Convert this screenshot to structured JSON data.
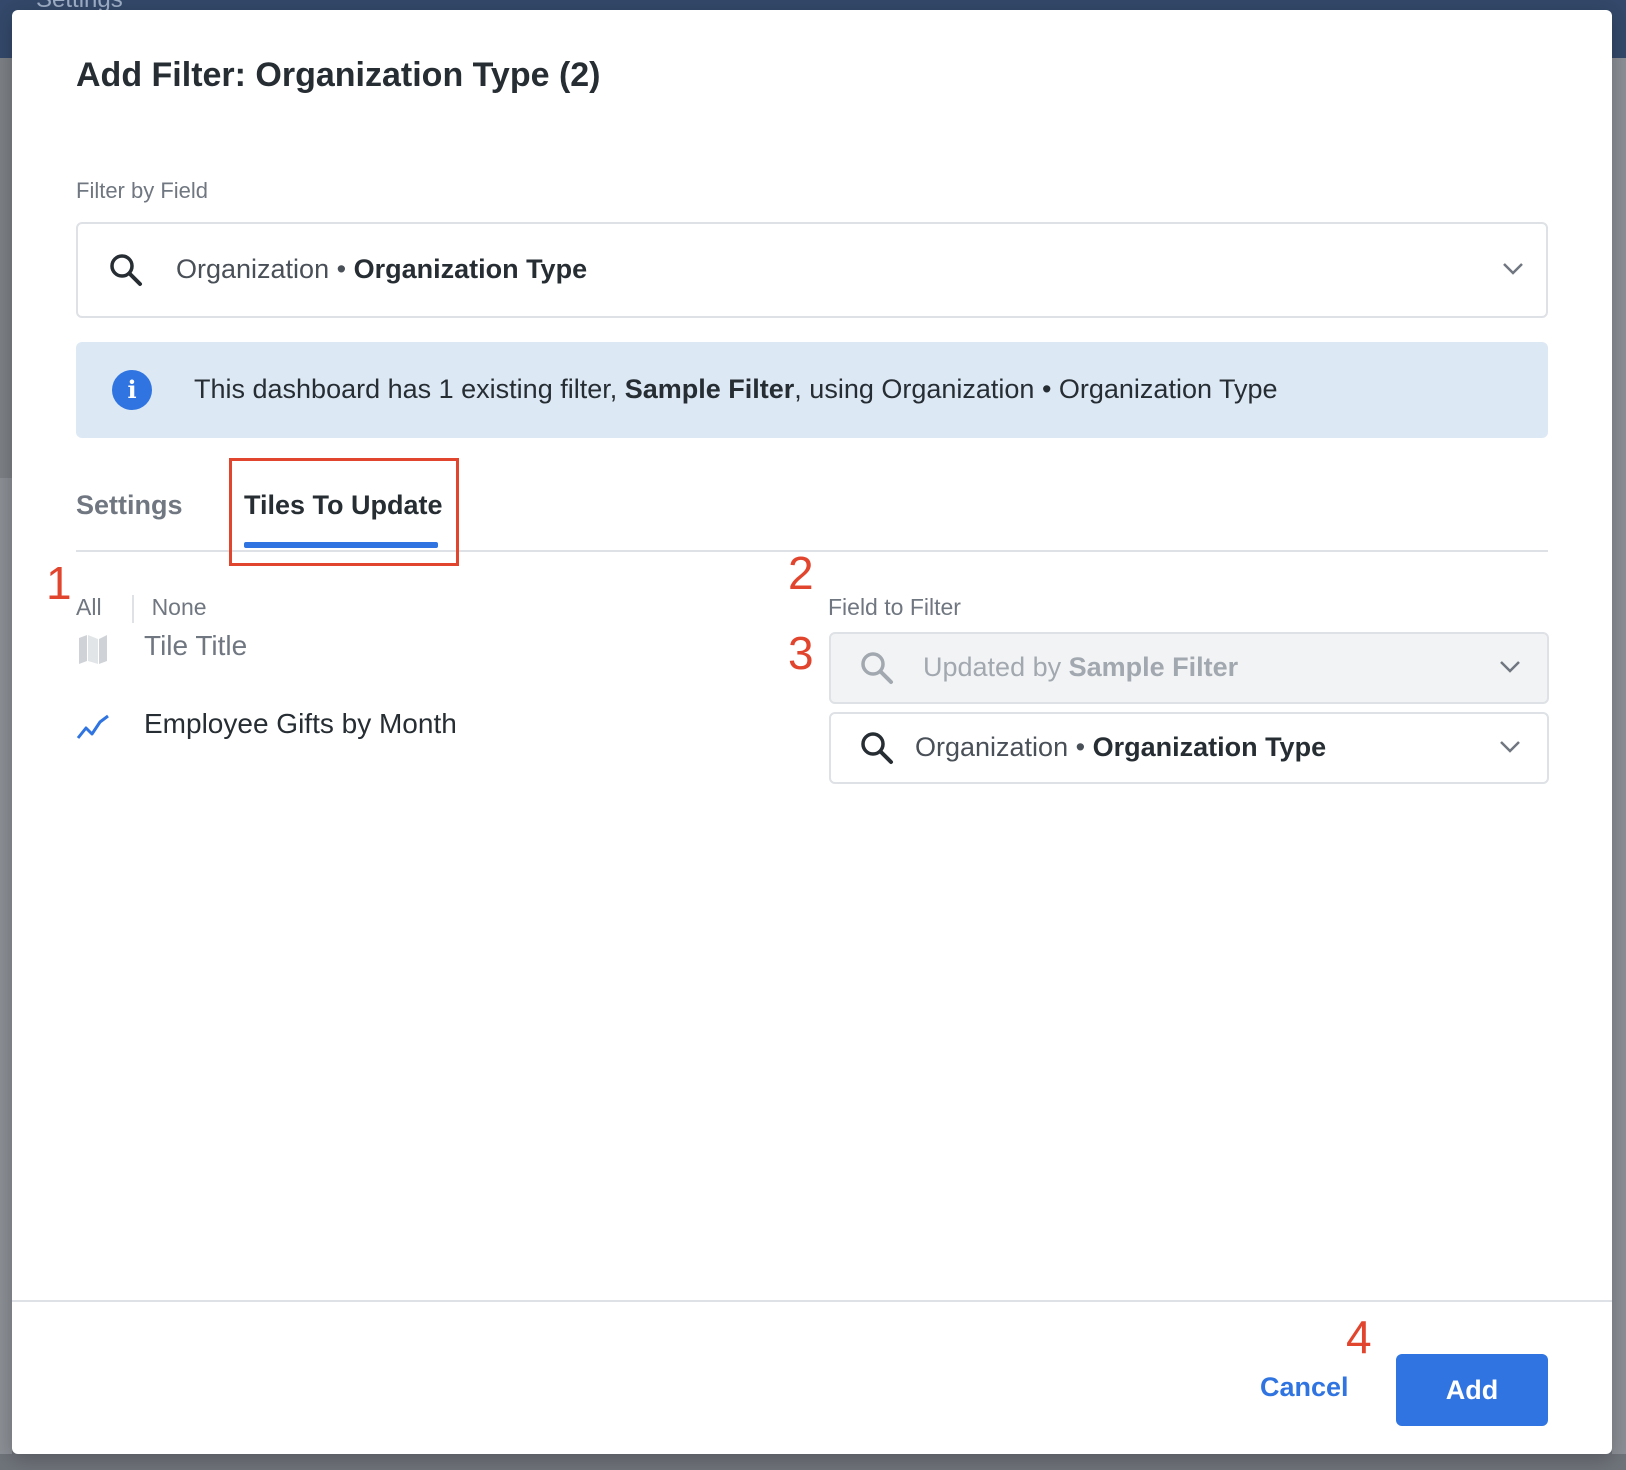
{
  "background": {
    "app_title": "Settings"
  },
  "modal": {
    "title": "Add Filter: Organization Type (2)",
    "filter_by_field": {
      "label": "Filter by Field",
      "value_prefix": "Organization",
      "separator": " • ",
      "value_bold": "Organization Type"
    },
    "info": {
      "text_before": "This dashboard has 1 existing filter, ",
      "text_bold": "Sample Filter",
      "text_after": ", using Organization • Organization Type"
    },
    "tabs": [
      {
        "label": "Settings",
        "active": false
      },
      {
        "label": "Tiles To Update",
        "active": true
      }
    ],
    "select_links": {
      "all": "All",
      "none": "None"
    },
    "tiles": [
      {
        "icon": "map-icon",
        "title": "Tile Title"
      },
      {
        "icon": "line-chart-icon",
        "title": "Employee Gifts by Month"
      }
    ],
    "field_to_filter_label": "Field to Filter",
    "tile_fields": [
      {
        "prefix": "Updated by ",
        "bold": "Sample Filter",
        "disabled": true
      },
      {
        "prefix": "Organization",
        "separator": " • ",
        "bold": "Organization Type",
        "disabled": false
      }
    ],
    "footer": {
      "cancel_label": "Cancel",
      "add_label": "Add"
    }
  },
  "annotations": [
    "1",
    "2",
    "3",
    "4"
  ],
  "colors": {
    "accent": "#2f74e0",
    "annotation": "#e2452e",
    "info_bg": "#dde8f5",
    "title_text": "#262d33"
  }
}
